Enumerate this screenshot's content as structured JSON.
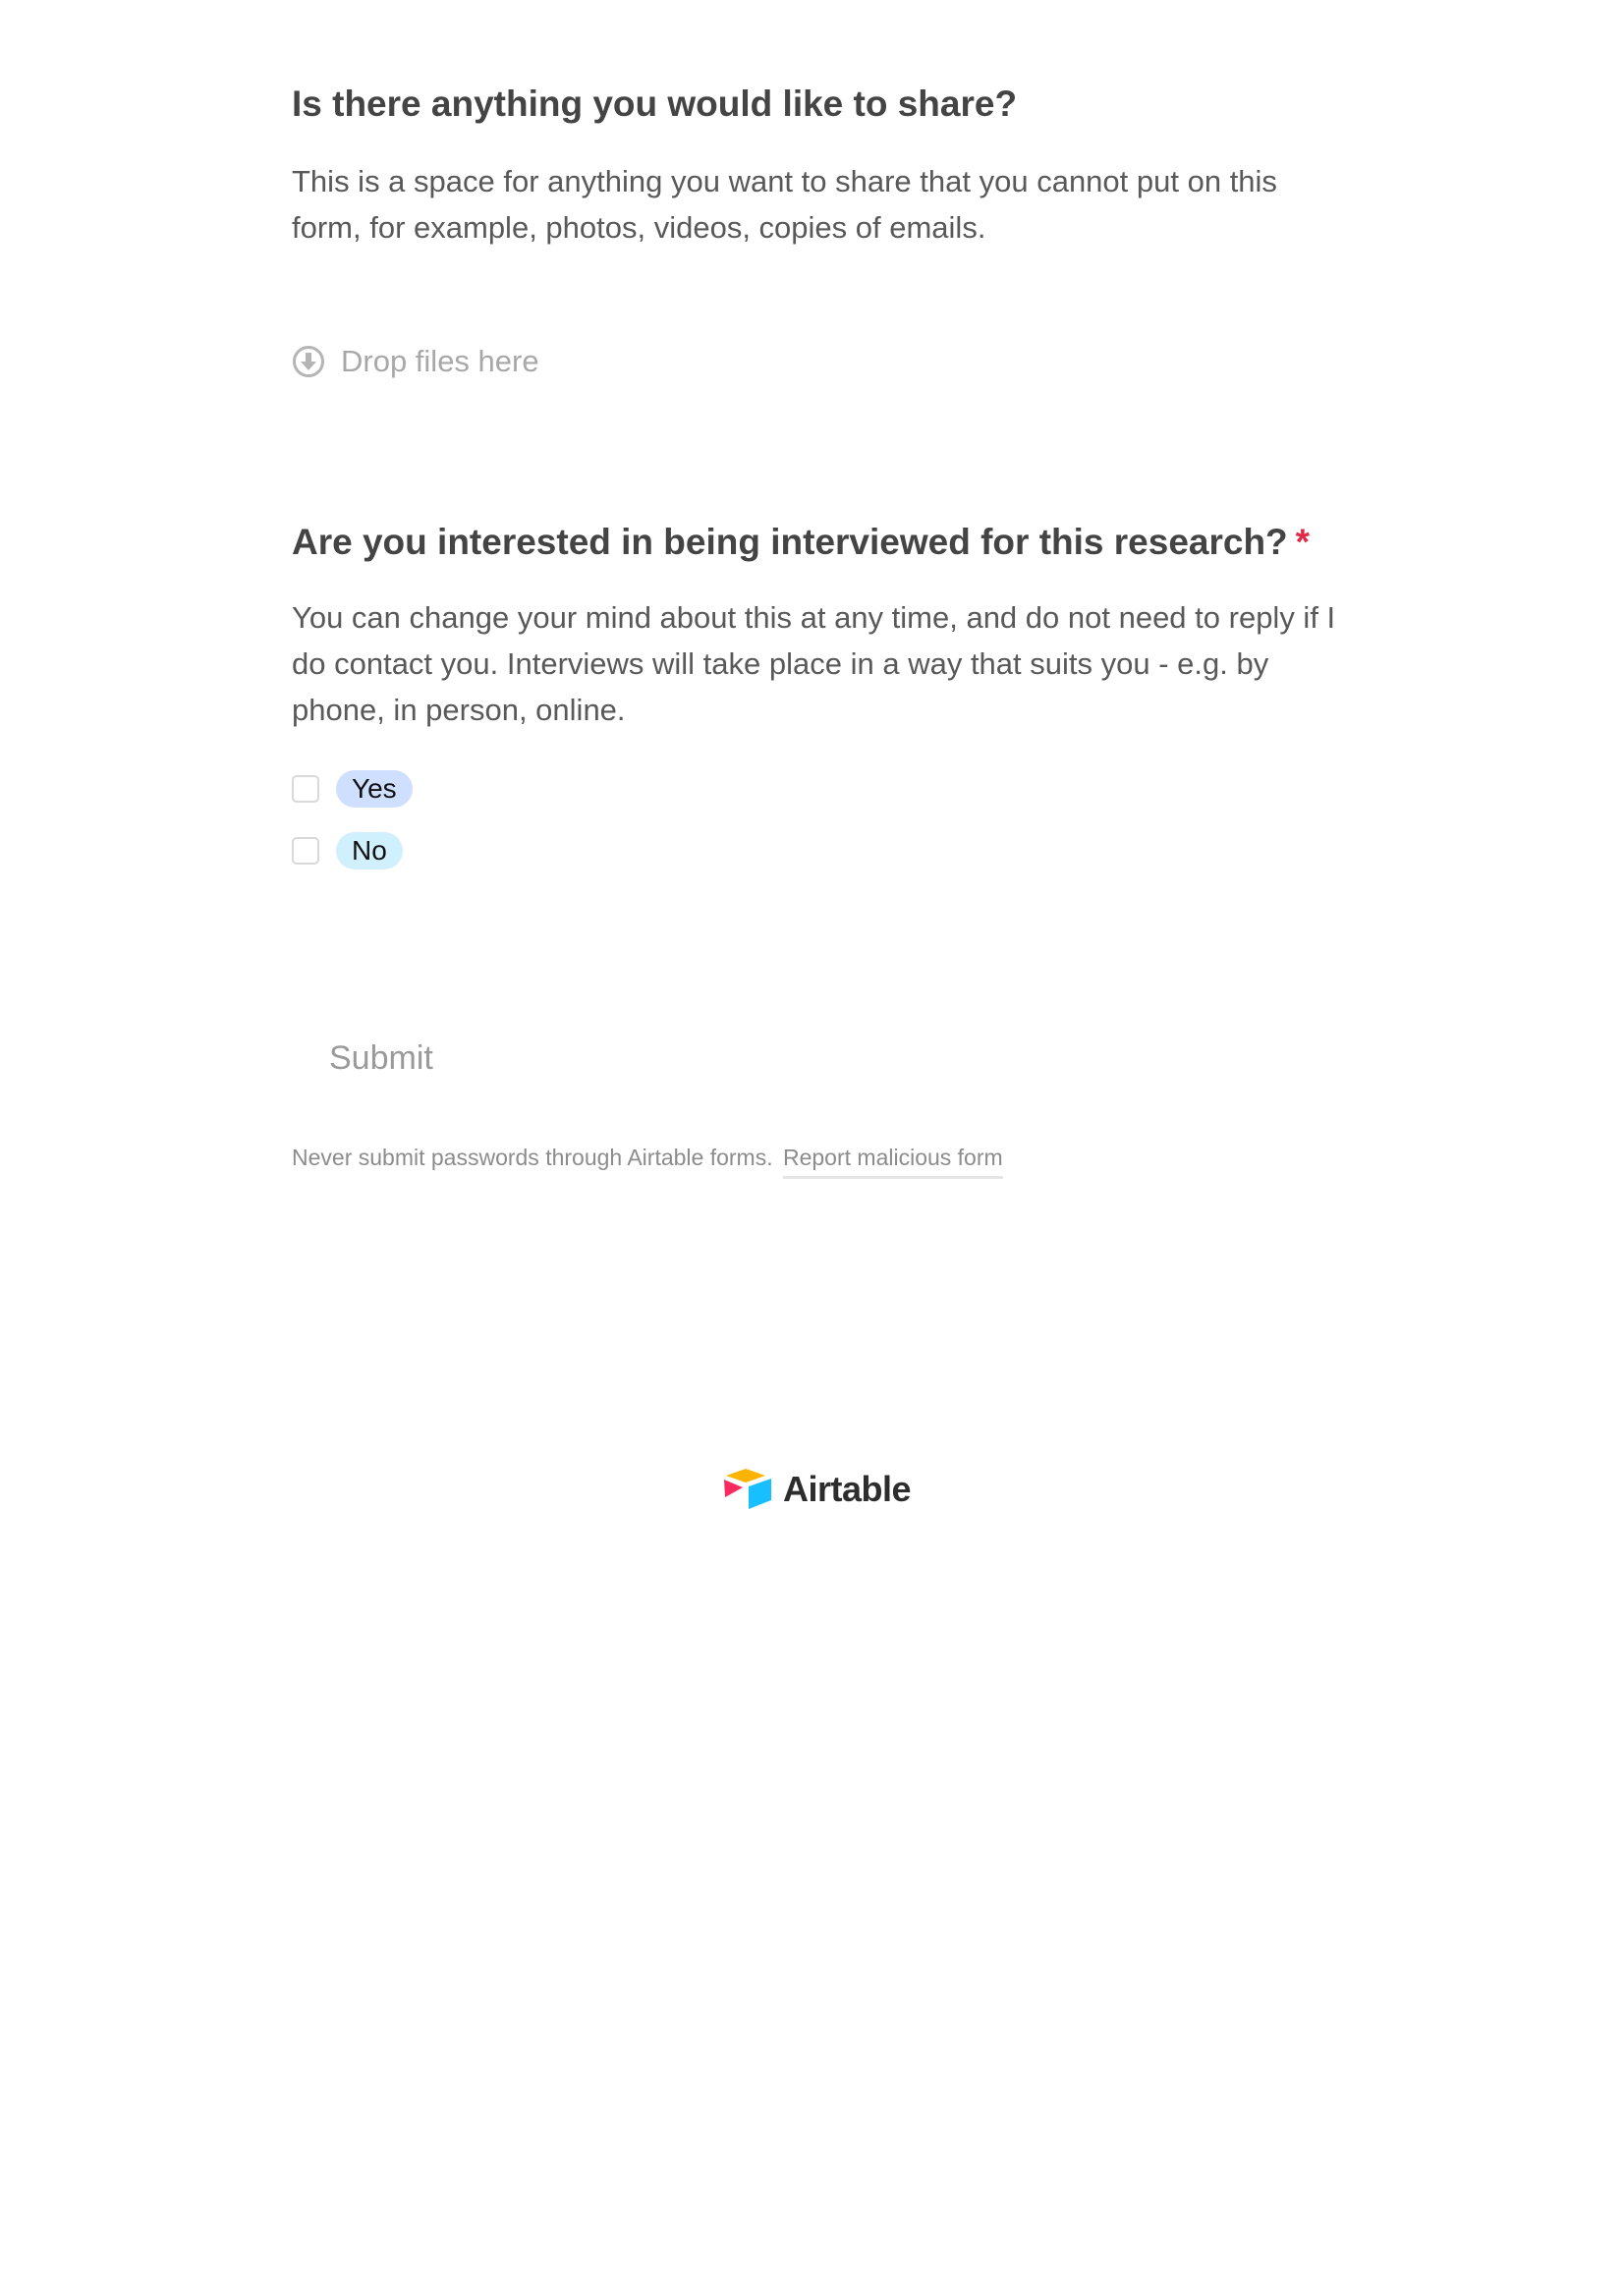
{
  "share_field": {
    "title": "Is there anything you would like to share?",
    "description": "This is a space for anything you want to share that you cannot put on this form, for example, photos, videos, copies of emails.",
    "dropzone_label": "Drop files here",
    "dropzone_icon": "download-circle-icon"
  },
  "interview_field": {
    "title": "Are you interested in being interviewed for this research?",
    "required_marker": "*",
    "description": "You can change your mind about this at any time, and do not need to reply if I do contact you. Interviews will take place in a way that suits you - e.g. by phone, in person, online.",
    "options": [
      {
        "label": "Yes",
        "color": "#cfdfff",
        "checked": false
      },
      {
        "label": "No",
        "color": "#d0f0fd",
        "checked": false
      }
    ]
  },
  "submit": {
    "label": "Submit"
  },
  "footer": {
    "note": "Never submit passwords through Airtable forms.",
    "report_link": "Report malicious form"
  },
  "brand": {
    "name": "Airtable",
    "logo_icon": "airtable-logo-icon"
  },
  "colors": {
    "required": "#e02a47",
    "title_text": "#444444",
    "body_text": "#595959",
    "muted_text": "#a8a8a8"
  }
}
